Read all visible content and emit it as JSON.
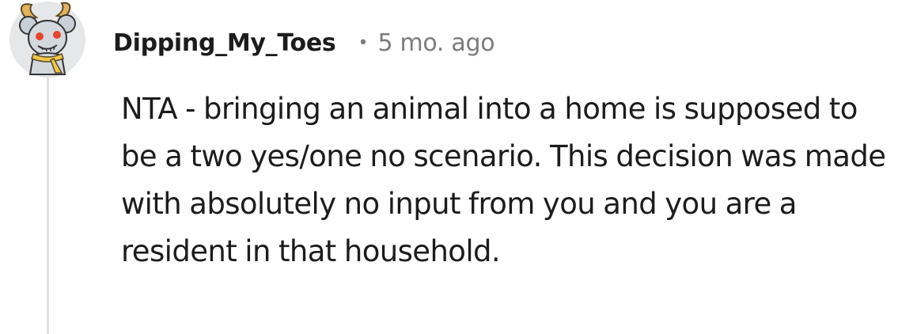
{
  "comment": {
    "author": "Dipping_My_Toes",
    "separator": "•",
    "timestamp": "5 mo. ago",
    "body": "NTA - bringing an animal into a home is supposed to be a two yes/one no scenario. This decision was made with absolutely no input from you and you are a resident in that household.",
    "avatar": "snoo-avatar-icon"
  },
  "colors": {
    "author": "#1c1c1c",
    "meta": "#7c7c7c",
    "thread_line": "#e0e0e0",
    "avatar_bg": "#e6e7e9"
  }
}
